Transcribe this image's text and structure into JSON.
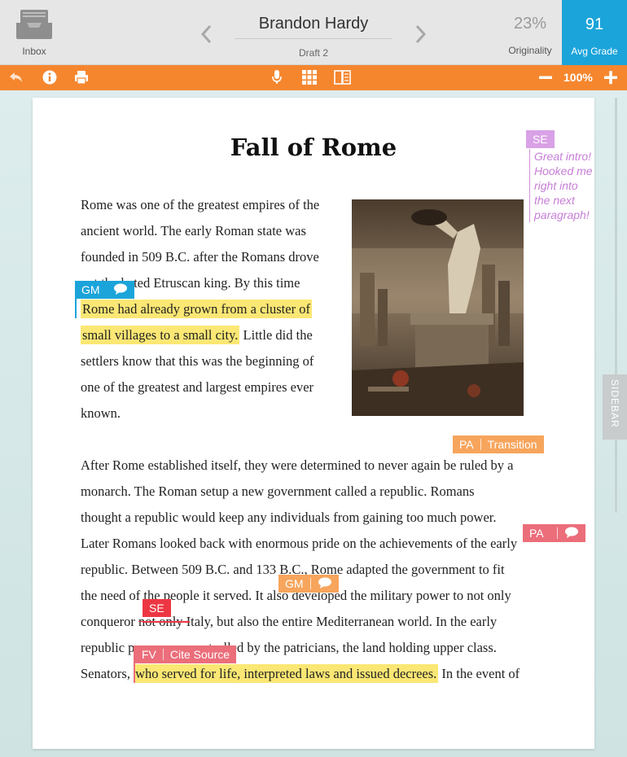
{
  "header": {
    "inbox_label": "Inbox",
    "student_name": "Brandon Hardy",
    "draft_label": "Draft 2",
    "originality_value": "23%",
    "originality_label": "Originality",
    "avg_grade_value": "91",
    "avg_grade_label": "Avg Grade"
  },
  "toolbar": {
    "zoom": "100%",
    "icons": [
      "undo-icon",
      "info-icon",
      "print-icon",
      "microphone-icon",
      "grid-icon",
      "book-icon",
      "zoom-out-icon",
      "zoom-in-icon"
    ]
  },
  "essay": {
    "title": "Fall of Rome",
    "p1": [
      "Rome was one of the greatest empires of the",
      "ancient world. The early Roman state was",
      "founded in 509 B.C. after the Romans drove",
      "out the hated Etruscan king. By this time",
      "Rome had already grown from a cluster of",
      "small villages to a small city.",
      " Little did the",
      "settlers know that this was the beginning of",
      "one of the greatest and largest empires ever",
      "known."
    ],
    "p2": [
      "After Rome established itself, they were determined to never again be ruled by a",
      "monarch. The Roman setup a new government called a republic. Romans",
      "thought a republic would keep any individuals from gaining too much power.",
      "Later Romans looked back with enormous pride on the achievements of the early",
      "republic. Between 509 B.C. and 133 B.C., Rome adapted the government to fit",
      "the need of the people it served. It also developed the military power to not only",
      "conqueror ",
      "not only",
      " Italy, but also the entire Mediterranean world. In the early",
      "republic power was controlled by the patricians, the land holding upper class.",
      "Senators, ",
      "who served for life, interpreted laws and issued decrees.",
      " In the event of"
    ]
  },
  "annotations": {
    "se_top": "SE",
    "se_comment": "Great intro! Hooked me right into the next paragraph!",
    "gm1": "GM",
    "pa_transition_code": "PA",
    "pa_transition_label": "Transition",
    "pa2": "PA",
    "gm2": "GM",
    "se2": "SE",
    "fv_code": "FV",
    "fv_label": "Cite Source"
  },
  "sidebar": {
    "label": "SIDEBAR"
  },
  "colors": {
    "orange": "#f5862e",
    "blue": "#1ba4da",
    "purple": "#d9a1e6",
    "red": "#ec3743",
    "pink": "#eb6e7a",
    "highlight": "#fbe774"
  }
}
